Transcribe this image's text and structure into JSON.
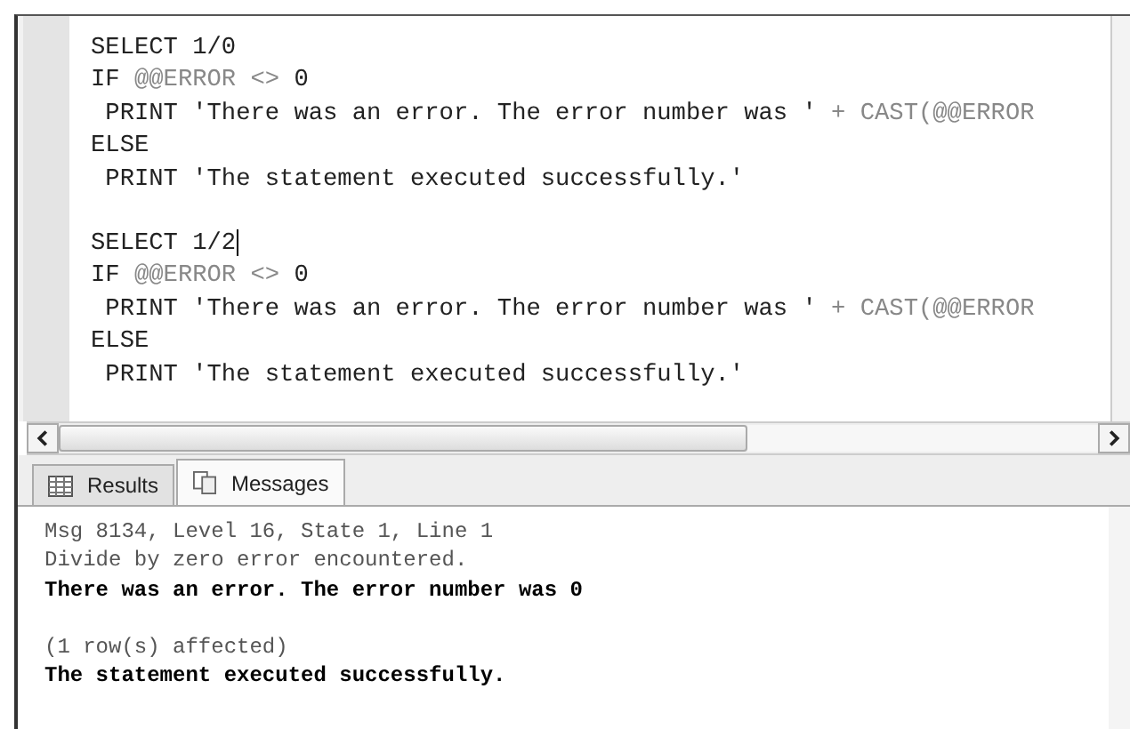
{
  "editor": {
    "blocks": [
      [
        {
          "caret": false,
          "tokens": [
            {
              "text": "SELECT 1/0",
              "kind": "plain"
            }
          ]
        },
        {
          "caret": false,
          "tokens": [
            {
              "text": "IF ",
              "kind": "plain"
            },
            {
              "text": "@@ERROR <>",
              "kind": "muted"
            },
            {
              "text": " 0",
              "kind": "plain"
            }
          ]
        },
        {
          "caret": false,
          "tokens": [
            {
              "text": " PRINT 'There was an error. The error number was '",
              "kind": "plain"
            },
            {
              "text": " + CAST(@@ERROR",
              "kind": "muted"
            }
          ]
        },
        {
          "caret": false,
          "tokens": [
            {
              "text": "ELSE",
              "kind": "plain"
            }
          ]
        },
        {
          "caret": false,
          "tokens": [
            {
              "text": " PRINT 'The statement executed successfully.'",
              "kind": "plain"
            }
          ]
        }
      ],
      [
        {
          "caret": true,
          "tokens": [
            {
              "text": "SELECT 1/2",
              "kind": "plain"
            }
          ]
        },
        {
          "caret": false,
          "tokens": [
            {
              "text": "IF ",
              "kind": "plain"
            },
            {
              "text": "@@ERROR <>",
              "kind": "muted"
            },
            {
              "text": " 0",
              "kind": "plain"
            }
          ]
        },
        {
          "caret": false,
          "tokens": [
            {
              "text": " PRINT 'There was an error. The error number was '",
              "kind": "plain"
            },
            {
              "text": " + CAST(@@ERROR",
              "kind": "muted"
            }
          ]
        },
        {
          "caret": false,
          "tokens": [
            {
              "text": "ELSE",
              "kind": "plain"
            }
          ]
        },
        {
          "caret": false,
          "tokens": [
            {
              "text": " PRINT 'The statement executed successfully.'",
              "kind": "plain"
            }
          ]
        }
      ]
    ]
  },
  "tabs": [
    {
      "label": "Results",
      "kind": "grid",
      "selected": false
    },
    {
      "label": "Messages",
      "kind": "document",
      "selected": true
    }
  ],
  "messages": {
    "groups": [
      [
        {
          "text": "Msg 8134, Level 16, State 1, Line 1",
          "kind": "error"
        },
        {
          "text": "Divide by zero error encountered.",
          "kind": "error"
        },
        {
          "text": "There was an error. The error number was 0",
          "kind": "output"
        }
      ],
      [
        {
          "text": "(1 row(s) affected)",
          "kind": "error"
        },
        {
          "text": "The statement executed successfully.",
          "kind": "output"
        }
      ]
    ]
  }
}
